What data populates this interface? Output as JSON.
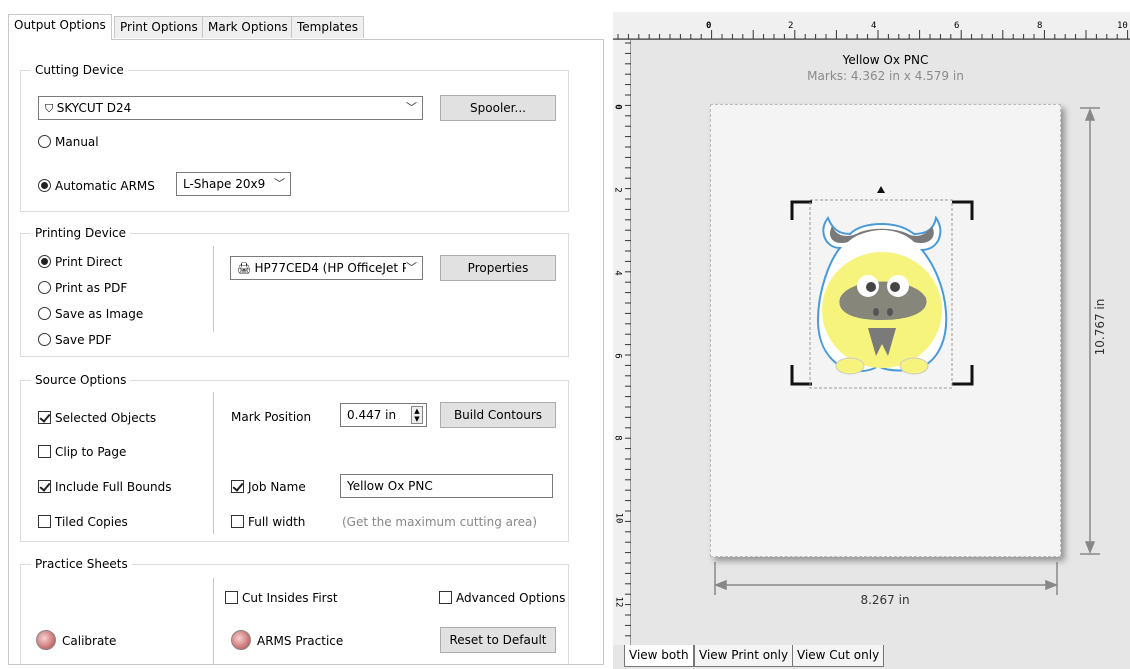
{
  "tabs": [
    "Output Options",
    "Print Options",
    "Mark Options",
    "Templates"
  ],
  "cutting_device": {
    "title": "Cutting Device",
    "device": "SKYCUT D24",
    "spooler_label": "Spooler...",
    "manual_label": "Manual",
    "automatic_label": "Automatic ARMS",
    "arms_shape": "L-Shape 20x9"
  },
  "printing_device": {
    "title": "Printing Device",
    "options": [
      "Print Direct",
      "Print as PDF",
      "Save as Image",
      "Save PDF"
    ],
    "selected": "Print Direct",
    "printer": "HP77CED4 (HP OfficeJet P",
    "properties_label": "Properties"
  },
  "source_options": {
    "title": "Source Options",
    "selected_objects": "Selected Objects",
    "clip_to_page": "Clip to Page",
    "include_full_bounds": "Include Full Bounds",
    "tiled_copies": "Tiled Copies",
    "mark_position_label": "Mark Position",
    "mark_position_value": "0.447 in",
    "build_contours_label": "Build Contours",
    "job_name_label": "Job Name",
    "job_name_value": "Yellow Ox PNC",
    "full_width_label": "Full width",
    "full_width_hint": "(Get the maximum cutting area)"
  },
  "practice_sheets": {
    "title": "Practice Sheets",
    "cut_insides_first": "Cut Insides First",
    "advanced_options": "Advanced Options",
    "calibrate": "Calibrate",
    "arms_practice": "ARMS Practice",
    "reset_label": "Reset to Default"
  },
  "preview": {
    "job_title": "Yellow Ox PNC",
    "marks": "Marks: 4.362 in x 4.579 in",
    "height": "10.767 in",
    "width": "8.267 in",
    "ruler_h": [
      "0",
      "2",
      "4",
      "6",
      "8",
      "10"
    ],
    "ruler_v": [
      "0",
      "2",
      "4",
      "6",
      "8",
      "10",
      "12"
    ],
    "view_tabs": [
      "View both",
      "View Print only",
      "View Cut only"
    ]
  },
  "colors": {
    "ox_yellow": "#f7f47e",
    "ox_gray": "#7a7a7a",
    "contour": "#4a9ad8"
  }
}
